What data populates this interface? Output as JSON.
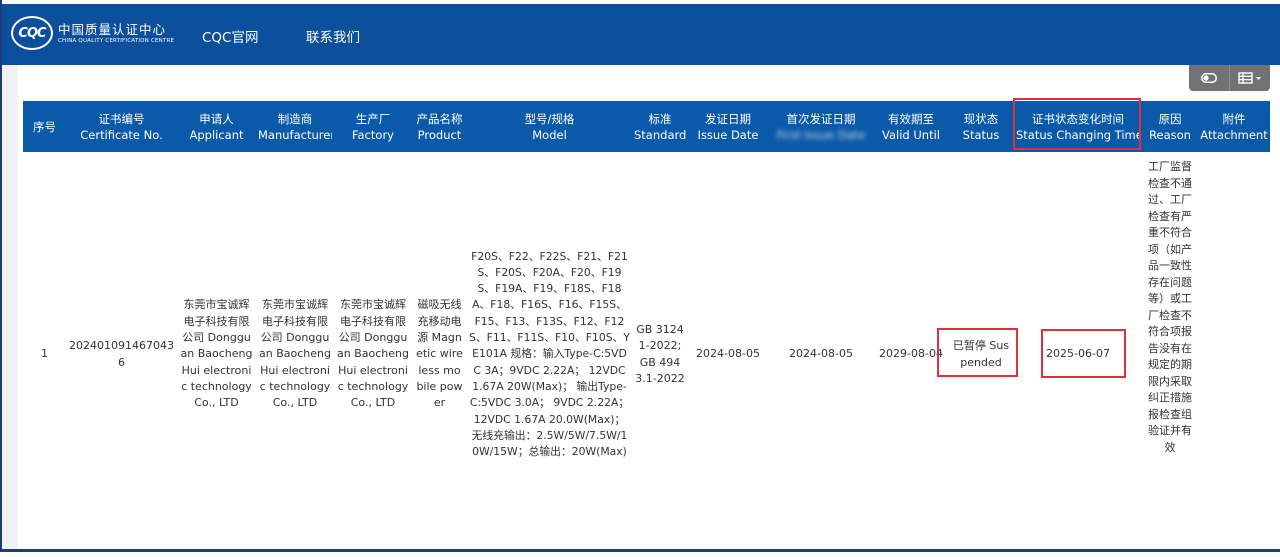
{
  "header": {
    "logo_mark": "CQC",
    "logo_cn": "中国质量认证中心",
    "logo_en": "CHINA QUALITY CERTIFICATION CENTRE",
    "nav_items": [
      "CQC官网",
      "联系我们"
    ],
    "bg_color": "#0b4f9d"
  },
  "toolbar": {
    "icons": [
      "toggle-icon",
      "table-columns-icon",
      "caret-down-icon"
    ]
  },
  "table": {
    "header_color": "#0b5aaa",
    "columns": [
      {
        "cn": "序号",
        "en": ""
      },
      {
        "cn": "证书编号",
        "en": "Certificate No."
      },
      {
        "cn": "申请人",
        "en": "Applicant"
      },
      {
        "cn": "制造商",
        "en": "Manufacturer"
      },
      {
        "cn": "生产厂",
        "en": "Factory"
      },
      {
        "cn": "产品名称",
        "en": "Product"
      },
      {
        "cn": "型号/规格",
        "en": "Model"
      },
      {
        "cn": "标准",
        "en": "Standard"
      },
      {
        "cn": "发证日期",
        "en": "Issue Date"
      },
      {
        "cn": "首次发证日期",
        "en": "First Issue Date"
      },
      {
        "cn": "有效期至",
        "en": "Valid Until"
      },
      {
        "cn": "现状态",
        "en": "Status"
      },
      {
        "cn": "证书状态变化时间",
        "en": "Status Changing Time"
      },
      {
        "cn": "原因",
        "en": "Reason"
      },
      {
        "cn": "附件",
        "en": "Attachment"
      }
    ],
    "row": {
      "index": "1",
      "certificate_no": "2024010914670436",
      "applicant": "东莞市宝诚辉电子科技有限公司 Dongguan Baocheng Hui electronic technology Co., LTD",
      "manufacturer": "东莞市宝诚辉电子科技有限公司 Dongguan Baocheng Hui electronic technology Co., LTD",
      "factory": "东莞市宝诚辉电子科技有限公司 Dongguan Baocheng Hui electronic technology Co., LTD",
      "product": "磁吸无线充移动电源 Magnetic wireless mobile power",
      "model": "F20S、F22、F22S、F21、F21S、F20S、F20A、F20、F19S、F19A、F19、F18S、F18A、F18、F16S、F16、F15S、F15、F13、F13S、F12、F12S、F11、F11S、F10、F10S、YE101A 规格：输入Type-C:5VDC 3A；9VDC 2.22A； 12VDC 1.67A 20W(Max)； 输出Type-C:5VDC 3.0A； 9VDC 2.22A； 12VDC 1.67A 20.0W(Max)； 无线充输出：2.5W/5W/7.5W/10W/15W；总输出：20W(Max)",
      "standard": "GB 31241-2022;GB 4943.1-2022",
      "issue_date": "2024-08-05",
      "first_issue_date": "2024-08-05",
      "valid_until": "2029-08-04",
      "status": "已暂停 Suspended",
      "status_change_time": "2025-06-07",
      "reason": "工厂监督检查不通过、工厂检查有严重不符合项（如产品一致性存在问题等）或工厂检查不符合项报告没有在规定的期限内采取纠正措施报检查组验证并有效",
      "attachment": ""
    }
  },
  "annotation_color": "#e0303a"
}
